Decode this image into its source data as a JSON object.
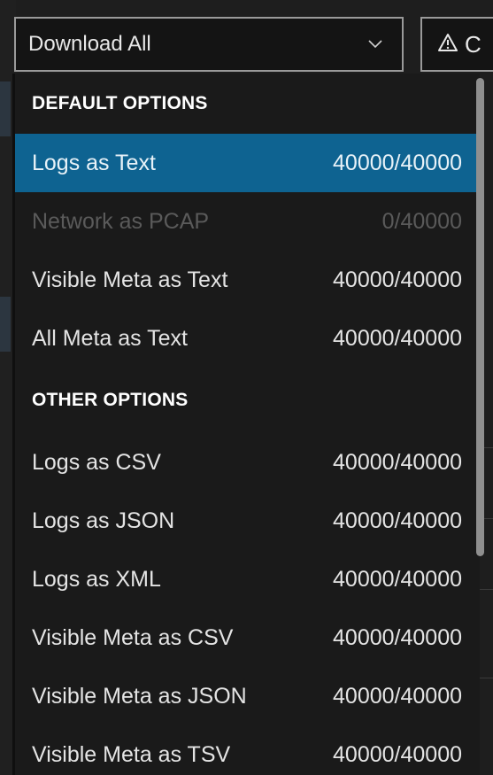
{
  "select": {
    "value": "Download All",
    "icon": "chevron-down-icon"
  },
  "warn_button": {
    "icon": "warning-triangle-icon",
    "label": "C"
  },
  "menu": {
    "groups": [
      {
        "header": "DEFAULT OPTIONS",
        "options": [
          {
            "label": "Logs as Text",
            "count": "40000/40000",
            "state": "selected"
          },
          {
            "label": "Network as PCAP",
            "count": "0/40000",
            "state": "disabled"
          },
          {
            "label": "Visible Meta as Text",
            "count": "40000/40000",
            "state": "normal"
          },
          {
            "label": "All Meta as Text",
            "count": "40000/40000",
            "state": "normal"
          }
        ]
      },
      {
        "header": "OTHER OPTIONS",
        "options": [
          {
            "label": "Logs as CSV",
            "count": "40000/40000",
            "state": "normal"
          },
          {
            "label": "Logs as JSON",
            "count": "40000/40000",
            "state": "normal"
          },
          {
            "label": "Logs as XML",
            "count": "40000/40000",
            "state": "normal"
          },
          {
            "label": "Visible Meta as CSV",
            "count": "40000/40000",
            "state": "normal"
          },
          {
            "label": "Visible Meta as JSON",
            "count": "40000/40000",
            "state": "normal"
          },
          {
            "label": "Visible Meta as TSV",
            "count": "40000/40000",
            "state": "normal"
          }
        ]
      }
    ]
  },
  "colors": {
    "selected_bg": "#0e6391",
    "disabled_text": "#5a5a5a",
    "menu_bg": "#1a1a1a"
  }
}
